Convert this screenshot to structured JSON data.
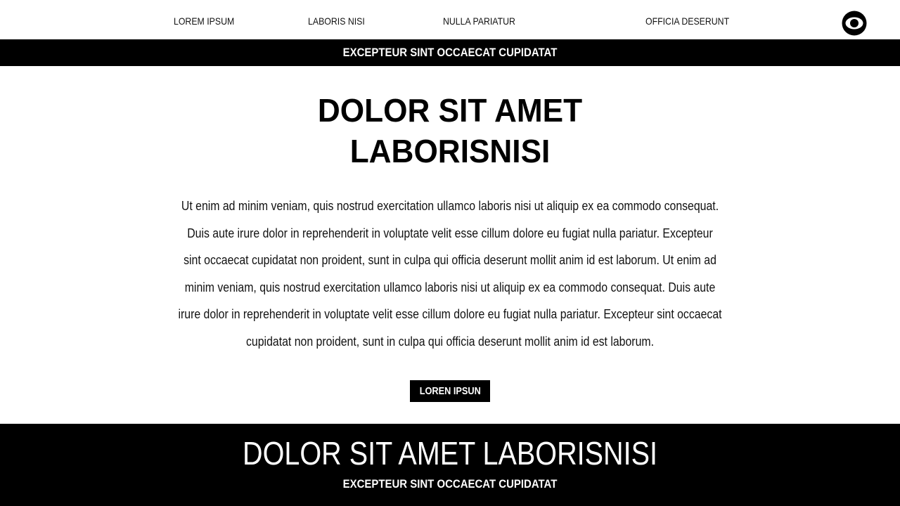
{
  "nav": {
    "items": [
      {
        "label": "LOREM IPSUM"
      },
      {
        "label": "LABORIS NISI"
      },
      {
        "label": "NULLA PARIATUR"
      },
      {
        "label": "OFFICIA DESERUNT"
      }
    ],
    "logo_icon": "eye-circle-icon"
  },
  "banner": {
    "text": "EXCEPTEUR SINT OCCAECAT CUPIDATAT"
  },
  "hero": {
    "title_line1": "DOLOR SIT AMET",
    "title_line2": "LABORISNISI",
    "body": "Ut enim ad minim veniam, quis nostrud exercitation ullamco laboris nisi ut aliquip ex ea commodo consequat. Duis aute irure dolor in reprehenderit in voluptate velit esse cillum dolore eu fugiat nulla pariatur. Excepteur sint occaecat cupidatat non proident, sunt in culpa qui officia deserunt mollit anim id est laborum. Ut enim ad minim veniam, quis nostrud exercitation ullamco laboris nisi ut aliquip ex ea commodo consequat. Duis aute irure dolor in reprehenderit in voluptate velit esse cillum dolore eu fugiat nulla pariatur. Excepteur sint occaecat cupidatat non proident, sunt in culpa qui officia deserunt mollit anim id est laborum.",
    "cta_label": "LOREN IPSUN"
  },
  "footer": {
    "title": "DOLOR SIT AMET LABORISNISI",
    "subtitle": "EXCEPTEUR SINT OCCAECAT CUPIDATAT"
  },
  "colors": {
    "background": "#ffffff",
    "foreground": "#000000",
    "inverse_text": "#ffffff"
  }
}
